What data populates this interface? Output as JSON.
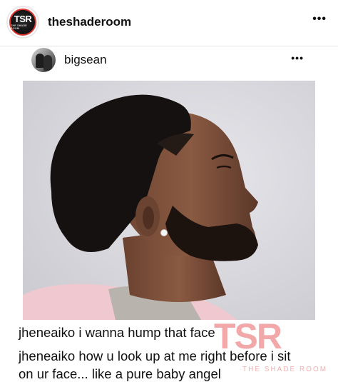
{
  "header": {
    "avatar_text": "TSR",
    "avatar_subtext": "THE SHADE ROOM",
    "username": "theshaderoom",
    "menu": "•••"
  },
  "embed": {
    "username": "bigsean",
    "menu": "•••"
  },
  "comments": [
    {
      "user": "jheneaiko",
      "text": "i wanna hump that face"
    },
    {
      "user": "jheneaiko",
      "text": "how u look up at me right before i sit"
    },
    {
      "continuation": "on ur face... like a pure baby angel"
    }
  ],
  "watermark": {
    "logo": "TSR",
    "tagline": "THE SHADE ROOM"
  },
  "colors": {
    "brand_red": "#e0342f",
    "text": "#111111",
    "photo_bg": "#d8d8de"
  }
}
